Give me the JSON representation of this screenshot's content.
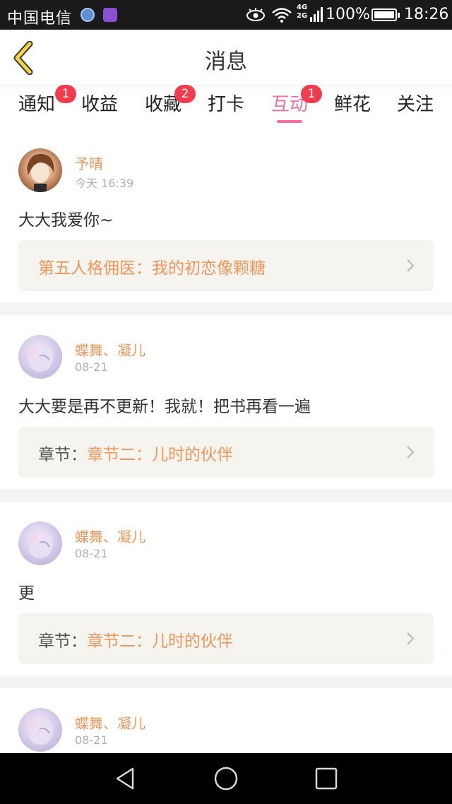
{
  "status_bar": {
    "carrier": "中国电信",
    "network": [
      "4G",
      "2G"
    ],
    "battery": "100%",
    "time": "18:26"
  },
  "header": {
    "title": "消息",
    "back_icon": "chevron-left-icon"
  },
  "tabs": [
    {
      "label": "通知",
      "badge": "1",
      "active": false
    },
    {
      "label": "收益",
      "badge": "",
      "active": false
    },
    {
      "label": "收藏",
      "badge": "2",
      "active": false
    },
    {
      "label": "打卡",
      "badge": "",
      "active": false
    },
    {
      "label": "互动",
      "badge": "1",
      "active": true
    },
    {
      "label": "鲜花",
      "badge": "",
      "active": false
    },
    {
      "label": "关注",
      "badge": "",
      "active": false
    }
  ],
  "messages": [
    {
      "username": "予晴",
      "time": "今天 16:39",
      "text": "大大我爱你~",
      "ref_prefix": "",
      "ref_title": "第五人格佣医：我的初恋像颗糖"
    },
    {
      "username": "蝶舞、凝儿",
      "time": "08-21",
      "text": "大大要是再不更新！我就！把书再看一遍",
      "ref_prefix": "章节：",
      "ref_title": "章节二：儿时的伙伴"
    },
    {
      "username": "蝶舞、凝儿",
      "time": "08-21",
      "text": "更",
      "ref_prefix": "章节：",
      "ref_title": "章节二：儿时的伙伴"
    },
    {
      "username": "蝶舞、凝儿",
      "time": "08-21"
    }
  ],
  "colors": {
    "accent_pink": "#ee6fa0",
    "username_orange": "#f2955a",
    "badge_red": "#f03c4c",
    "back_yellow": "#f5d443"
  },
  "nav_icons": [
    "back-triangle-icon",
    "home-circle-icon",
    "recent-square-icon"
  ]
}
